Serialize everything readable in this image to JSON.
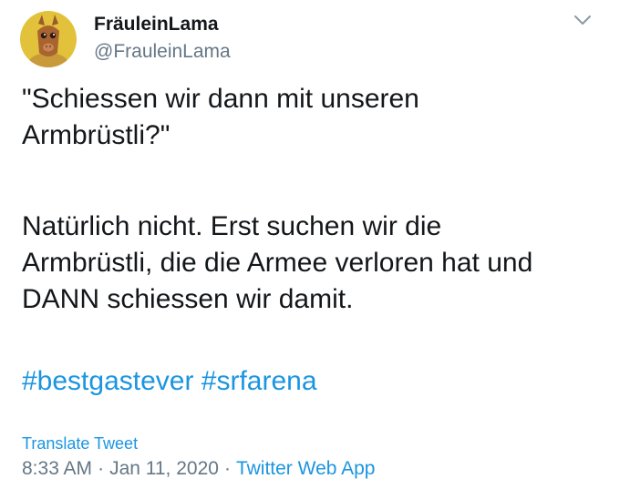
{
  "user": {
    "display_name": "FräuleinLama",
    "handle": "@FrauleinLama"
  },
  "tweet": {
    "paragraph_1": "\"Schiessen wir dann mit unseren\nArmbrüstli?\"",
    "paragraph_2": "Natürlich nicht. Erst suchen wir die\nArmbrüstli, die die Armee verloren hat und\nDANN schiessen wir damit.",
    "hashtags": [
      "#bestgastever",
      "#srfarena"
    ]
  },
  "translate_label": "Translate Tweet",
  "meta": {
    "time": "8:33 AM",
    "separator_1": "·",
    "date": "Jan 11, 2020",
    "separator_2": "·",
    "source": "Twitter Web App"
  },
  "icons": {
    "avatar": "llama-avatar-icon",
    "menu": "chevron-down-icon"
  },
  "colors": {
    "link": "#1b95e0",
    "secondary_text": "#657786",
    "primary_text": "#14171a",
    "avatar_background": "#e2c23a"
  }
}
